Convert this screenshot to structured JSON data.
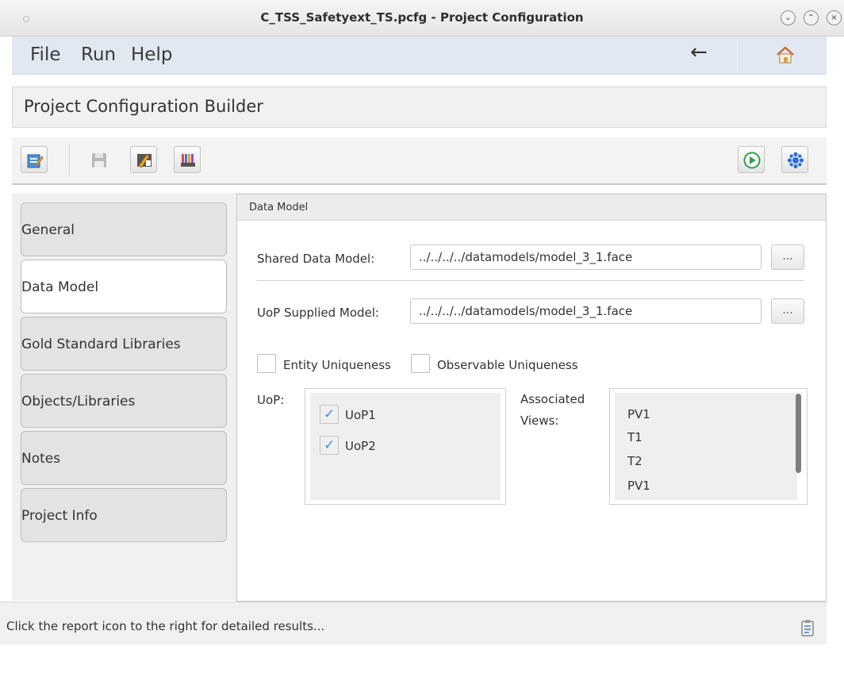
{
  "window": {
    "title": "C_TSS_Safetyext_TS.pcfg - Project Configuration",
    "controls": [
      "minimize-icon",
      "maximize-icon",
      "close-icon"
    ]
  },
  "menu": {
    "file": "File",
    "run": "Run",
    "help": "Help",
    "back_icon": "back-arrow-icon",
    "home_icon": "home-icon"
  },
  "header": {
    "title": "Project Configuration Builder"
  },
  "toolbar": {
    "left_icons": [
      "edit-config-icon",
      "save-icon",
      "tools-icon",
      "library-icon"
    ],
    "right_icons": [
      "run-icon",
      "settings-icon"
    ]
  },
  "nav": {
    "items": [
      {
        "label": "General"
      },
      {
        "label": "Data Model"
      },
      {
        "label": "Gold Standard Libraries"
      },
      {
        "label": "Objects/Libraries"
      },
      {
        "label": "Notes"
      },
      {
        "label": "Project Info"
      }
    ],
    "active": "Data Model"
  },
  "panel": {
    "title": "Data Model",
    "shared_label": "Shared Data Model:",
    "shared_value": "../../../../datamodels/model_3_1.face",
    "uop_supplied_label": "UoP Supplied Model:",
    "uop_supplied_value": "../../../../datamodels/model_3_1.face",
    "browse_label": "...",
    "entity_uniqueness": {
      "label": "Entity Uniqueness",
      "checked": false
    },
    "observable_uniqueness": {
      "label": "Observable Uniqueness",
      "checked": false
    },
    "uop_label": "UoP:",
    "uops": [
      {
        "label": "UoP1",
        "checked": true
      },
      {
        "label": "UoP2",
        "checked": true
      }
    ],
    "associated_views_label_1": "Associated",
    "associated_views_label_2": "Views:",
    "views": [
      "PV1",
      "T1",
      "T2",
      "PV1"
    ]
  },
  "status": {
    "text": "Click the report icon to the right for detailed results..."
  },
  "colors": {
    "menubar": "#e1e8f1",
    "check": "#3b8fd9",
    "run_green": "#2fa14a"
  }
}
